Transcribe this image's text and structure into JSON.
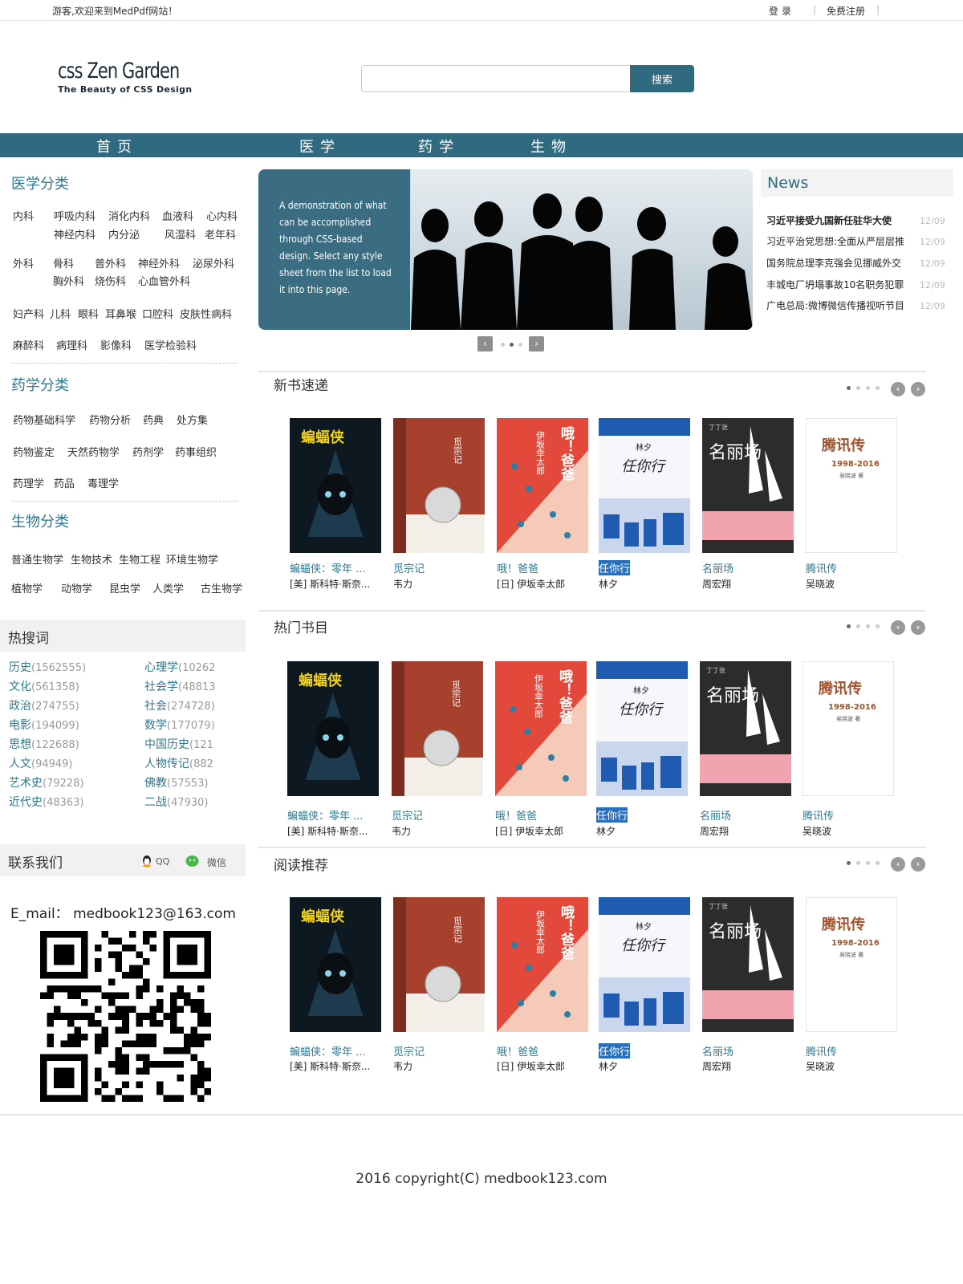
{
  "topbar": {
    "welcome": "游客,欢迎来到MedPdf网站！",
    "login": "登 录",
    "separator": "|",
    "register": "免费注册"
  },
  "logo": {
    "title": "css Zen Garden",
    "subtitle": "The Beauty of CSS Design"
  },
  "search": {
    "placeholder": "",
    "button": "搜索"
  },
  "nav": [
    "首页",
    "医学",
    "药学",
    "生物"
  ],
  "sidebar": {
    "medical_title": "医学分类",
    "medical_rows": [
      [
        "内科",
        "呼吸内科",
        "消化内科",
        "血液科",
        "心内科"
      ],
      [
        "神经内科",
        "内分泌",
        "风湿科",
        "老年科"
      ],
      [
        "外科",
        "骨科",
        "普外科",
        "神经外科",
        "泌尿外科"
      ],
      [
        "胸外科",
        "烧伤科",
        "心血管外科"
      ],
      [
        "妇产科",
        "儿科",
        "眼科",
        "耳鼻喉",
        "口腔科",
        "皮肤性病科"
      ],
      [
        "麻醉科",
        "病理科",
        "影像科",
        "医学检验科"
      ]
    ],
    "pharma_title": "药学分类",
    "pharma_rows": [
      [
        "药物基础科学",
        "药物分析",
        "药典",
        "处方集"
      ],
      [
        "药物鉴定",
        "天然药物学",
        "药剂学",
        "药事组织"
      ],
      [
        "药理学",
        "药品",
        "毒理学"
      ]
    ],
    "bio_title": "生物分类",
    "bio_rows": [
      [
        "普通生物学",
        "生物技术",
        "生物工程",
        "环境生物学"
      ],
      [
        "植物学",
        "动物学",
        "昆虫学",
        "人类学",
        "古生物学"
      ]
    ],
    "hot_title": "热搜词",
    "hot_left": [
      {
        "word": "历史",
        "count": "(1562555)"
      },
      {
        "word": "文化",
        "count": "(561358)"
      },
      {
        "word": "政治",
        "count": "(274755)"
      },
      {
        "word": "电影",
        "count": "(194099)"
      },
      {
        "word": "思想",
        "count": "(122688)"
      },
      {
        "word": "人文",
        "count": "(94949)"
      },
      {
        "word": "艺术史",
        "count": "(79228)"
      },
      {
        "word": "近代史",
        "count": "(48363)"
      }
    ],
    "hot_right": [
      {
        "word": "心理学",
        "count": "(10262"
      },
      {
        "word": "社会学",
        "count": "(48813"
      },
      {
        "word": "社会",
        "count": "(274728)"
      },
      {
        "word": "数学",
        "count": "(177079)"
      },
      {
        "word": "中国历史",
        "count": "(121"
      },
      {
        "word": "人物传记",
        "count": "(882"
      },
      {
        "word": "佛教",
        "count": "(57553)"
      },
      {
        "word": "二战",
        "count": "(47930)"
      }
    ],
    "contact_title": "联系我们",
    "qq": "QQ",
    "wechat": "微信",
    "email": "E_mail： medbook123@163.com"
  },
  "banner": {
    "text": "A demonstration of what can be accomplished through CSS-based design. Select any style sheet from the list to load it into this page.",
    "prev": "‹",
    "next": "›"
  },
  "news": {
    "title": "News",
    "items": [
      {
        "text": "习近平接受九国新任驻华大使",
        "date": "12/09"
      },
      {
        "text": "习近平治党思想:全面从严层层推",
        "date": "12/09"
      },
      {
        "text": "国务院总理李克强会见挪威外交",
        "date": "12/09"
      },
      {
        "text": "丰城电厂坍塌事故10名职务犯罪",
        "date": "12/09"
      },
      {
        "text": "广电总局:微博微信传播视听节目",
        "date": "12/09"
      }
    ]
  },
  "sections": [
    {
      "title": "新书速递"
    },
    {
      "title": "热门书目"
    },
    {
      "title": "阅读推荐"
    }
  ],
  "books": [
    {
      "title": "蝙蝠侠：零年 ...",
      "author": "[美] 斯科特·斯奈...",
      "cover": "batman"
    },
    {
      "title": "觅宗记",
      "author": "韦力",
      "cover": "mizong"
    },
    {
      "title": "哦！爸爸",
      "author": "[日] 伊坂幸太郎",
      "cover": "oh"
    },
    {
      "title": "任你行",
      "author": "林夕",
      "cover": "renni"
    },
    {
      "title": "名丽场",
      "author": "周宏翔",
      "cover": "mingli"
    },
    {
      "title": "腾讯传",
      "author": "吴晓波",
      "cover": "tencent"
    }
  ],
  "book_cover_text": {
    "batman": "蝙蝠侠",
    "mizong": "觅宗记",
    "oh_a": "伊坂幸太郎",
    "oh_b": "哦！爸爸",
    "renni_a": "林夕",
    "renni_b": "任你行",
    "mingli_a": "丁丁张",
    "mingli_b": "名丽场",
    "tencent_a": "腾讯传",
    "tencent_b": "1998-2016",
    "tencent_c": "吴晓波 著"
  },
  "footer": {
    "copyright": "2016  copyright(C)  medbook123.com"
  },
  "colors": {
    "accent": "#2f6a80",
    "link": "#2f7891"
  }
}
